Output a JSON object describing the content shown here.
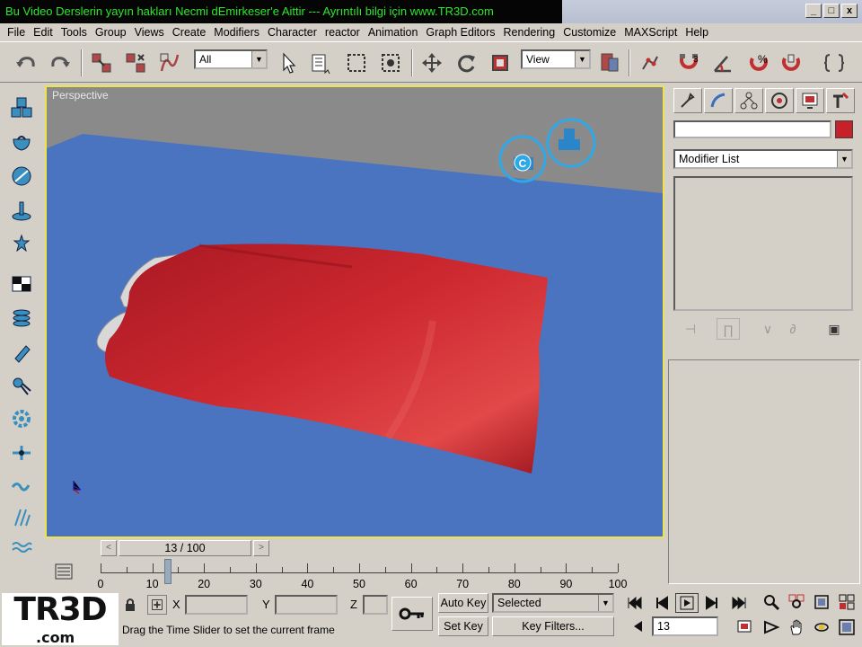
{
  "window": {
    "banner_text": "Bu Video Derslerin yayın hakları Necmi dEmirkeser'e Aittir --- Ayrıntılı bilgi için www.TR3D.com",
    "controls": [
      "_",
      "□",
      "x"
    ]
  },
  "menu": [
    "File",
    "Edit",
    "Tools",
    "Group",
    "Views",
    "Create",
    "Modifiers",
    "Character",
    "reactor",
    "Animation",
    "Graph Editors",
    "Rendering",
    "Customize",
    "MAXScript",
    "Help"
  ],
  "toolbar": {
    "selection_filter": "All",
    "reference_coord": "View",
    "snap_label": "3",
    "angle_snap_label": "%"
  },
  "viewport": {
    "label": "Perspective",
    "helper_label": "C",
    "colors": {
      "sky": "#8a8a8a",
      "ground": "#4a74c0",
      "sheet": "#c8202a",
      "frame": "#f0e34a"
    }
  },
  "command_panel": {
    "modifier_list": "Modifier List",
    "object_color": "#c8202a"
  },
  "time": {
    "slider_text": "13 / 100",
    "current_frame": 13,
    "total_frames": 100,
    "track_labels": [
      "0",
      "10",
      "20",
      "30",
      "40",
      "50",
      "60",
      "70",
      "80",
      "90",
      "100"
    ]
  },
  "status": {
    "logo": "TR3D",
    "logo_sub": ".com",
    "coord_labels": [
      "X",
      "Y",
      "Z"
    ],
    "prompt": "Drag the Time Slider to set the current frame",
    "auto_key": "Auto Key",
    "set_key": "Set Key",
    "selected": "Selected",
    "key_filters": "Key Filters...",
    "frame_value": "13"
  }
}
